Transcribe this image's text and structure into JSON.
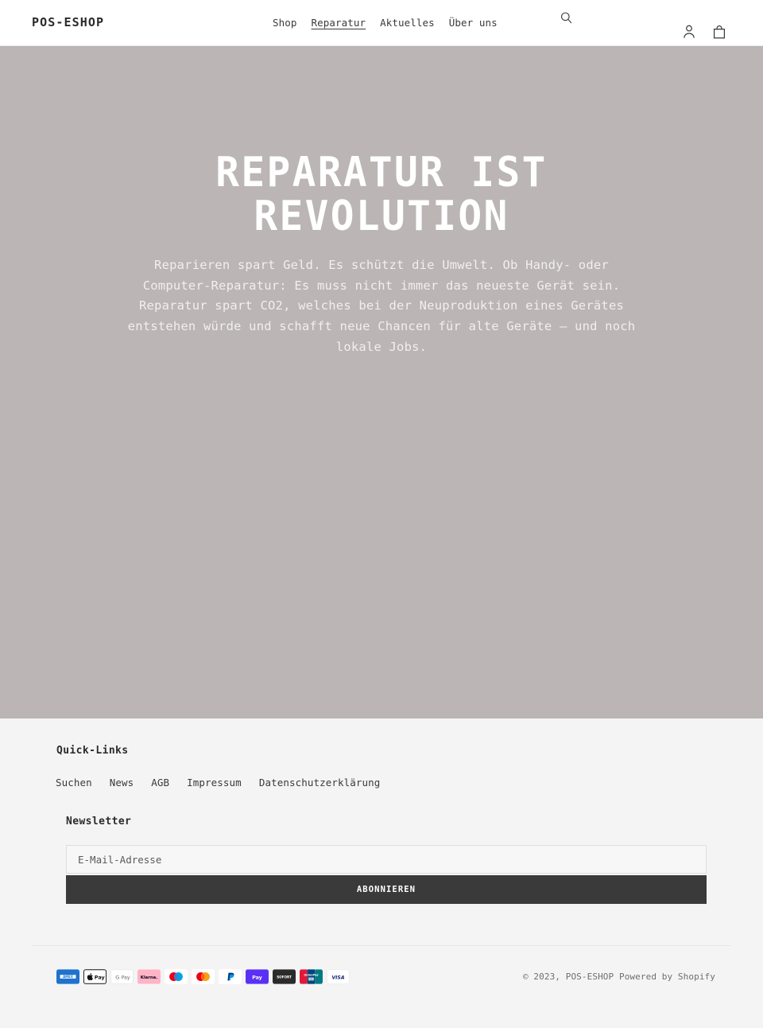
{
  "header": {
    "brand": "POS-ESHOP",
    "nav": [
      {
        "label": "Shop",
        "active": false
      },
      {
        "label": "Reparatur",
        "active": true
      },
      {
        "label": "Aktuelles",
        "active": false
      },
      {
        "label": "Über uns",
        "active": false
      }
    ],
    "search_icon": "search-icon",
    "search_label": "Suchen",
    "account_icon": "account-person-icon",
    "account_label": "Einloggen",
    "cart_icon": "shopping-cart-bag-icon",
    "cart_label": "Warenkorb"
  },
  "hero": {
    "title": "REPARATUR IST REVOLUTION",
    "paragraph1": "Reparieren spart Geld. Es schützt die Umwelt. Ob Handy- oder Computer-Reparatur: Es muss nicht immer das neueste Gerät sein.",
    "paragraph2": "Reparatur spart CO2, welches bei der Neuproduktion eines Gerätes entstehen würde und schafft neue Chancen für alte Geräte — und noch lokale Jobs.",
    "background_color": "#bbb5b5",
    "text_color": "#ffffff"
  },
  "footer": {
    "quick_links_heading": "Quick-Links",
    "quick_links": [
      "Suchen",
      "News",
      "AGB",
      "Impressum",
      "Datenschutzerklärung"
    ],
    "newsletter": {
      "heading": "Newsletter",
      "placeholder": "E-Mail-Adresse",
      "value": "",
      "submit_label": "ABONNIEREN",
      "submit_color": "#3a3a3a"
    },
    "payments": [
      {
        "name": "american-express",
        "label": "AMEX"
      },
      {
        "name": "apple-pay",
        "label": "Pay"
      },
      {
        "name": "google-pay",
        "label": "G Pay"
      },
      {
        "name": "klarna",
        "label": "Klarna."
      },
      {
        "name": "maestro",
        "label": "Maestro"
      },
      {
        "name": "mastercard",
        "label": "Mastercard"
      },
      {
        "name": "paypal",
        "label": "PayPal"
      },
      {
        "name": "shop-pay",
        "label": "Pay"
      },
      {
        "name": "sofort",
        "label": "SOFORT"
      },
      {
        "name": "union-pay",
        "label": "UnionPay"
      },
      {
        "name": "visa",
        "label": "VISA"
      }
    ],
    "copyright": "© 2023, POS-ESHOP",
    "powered_by": "Powered by Shopify",
    "background_color": "#f4f4f4"
  }
}
